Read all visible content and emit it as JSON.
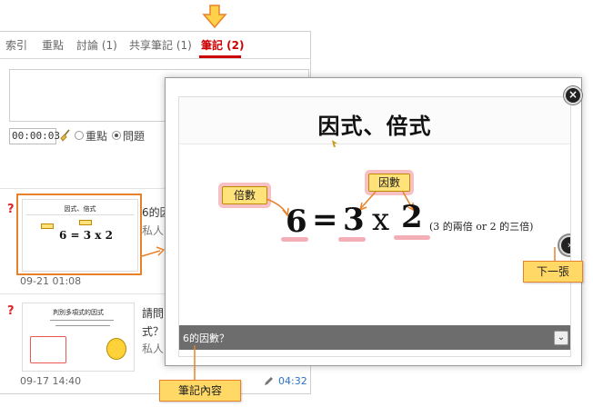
{
  "tabs": [
    {
      "label": "索引"
    },
    {
      "label": "重點"
    },
    {
      "label": "討論 (1)"
    },
    {
      "label": "共享筆記 (1)"
    },
    {
      "label": "筆記 (2)"
    }
  ],
  "note_editor": {
    "time_value": "00:00:03",
    "options": [
      {
        "label": "重點",
        "checked": false
      },
      {
        "label": "問題",
        "checked": true
      }
    ]
  },
  "notes": [
    {
      "thumb_title": "因式、倍式",
      "text_line1": "6的因",
      "text_line2": "私人",
      "timestamp": "09-21 01:08"
    },
    {
      "thumb_title": "判別多項式的因式",
      "text_line1": "請問",
      "text_line2": "式？",
      "text_line3": "私人",
      "timestamp": "09-17 14:40",
      "link_time": "04:32"
    }
  ],
  "viewer": {
    "slide_title": "因式、倍式",
    "label_multiple": "倍數",
    "label_factor": "因數",
    "eq_6": "6",
    "eq_equals": "=",
    "eq_3": "3",
    "eq_times": "x",
    "eq_2": "2",
    "eq_note": "(3 的兩倍 or 2 的三倍)",
    "next_symbol": "›",
    "caption": "6的因數？",
    "caption_toggle": "⌄",
    "close_symbol": "×"
  },
  "callouts": {
    "next": "下一張",
    "content": "筆記內容"
  },
  "colors": {
    "accent_red": "#cc0000",
    "callout_fill": "#ffd866",
    "callout_border": "#e8822a",
    "highlight_pink": "#f08c96"
  }
}
